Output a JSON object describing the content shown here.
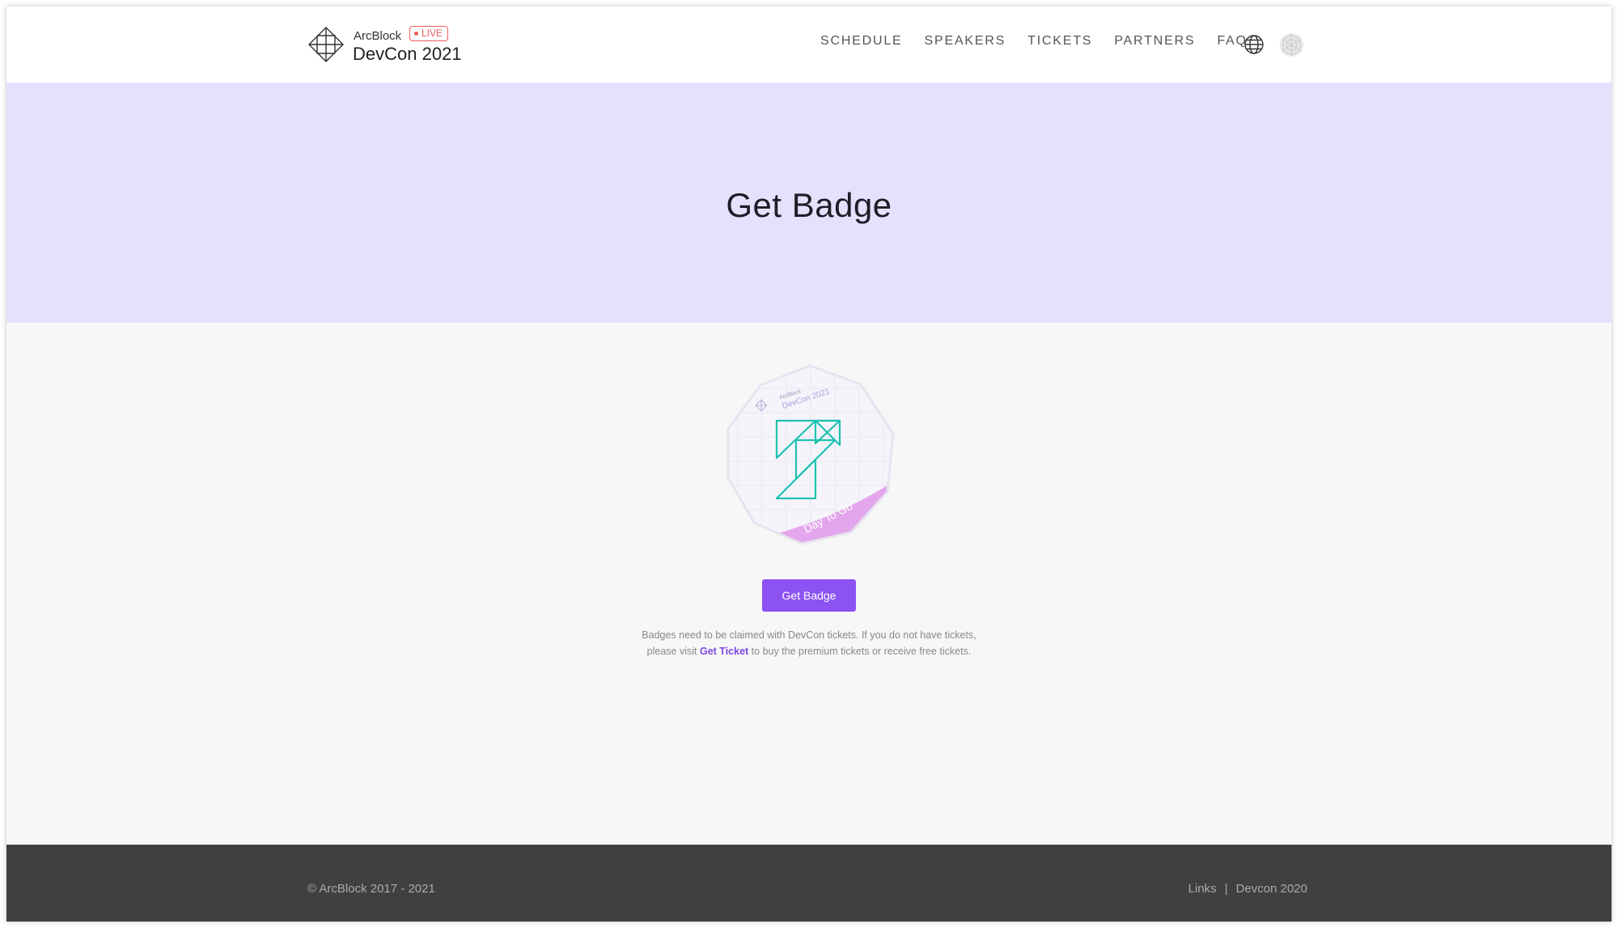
{
  "header": {
    "brand_small": "ArcBlock",
    "live_label": "LIVE",
    "brand_title": "DevCon 2021",
    "nav": [
      "SCHEDULE",
      "SPEAKERS",
      "TICKETS",
      "PARTNERS",
      "FAQ"
    ]
  },
  "hero": {
    "title": "Get Badge"
  },
  "badge": {
    "brand_small": "ArcBlock",
    "brand_title": "DevCon 2021",
    "ribbon": "Day To Go",
    "colors": {
      "accent": "#1ec2b0",
      "ribbon": "#e3a6ec"
    }
  },
  "main": {
    "button_label": "Get Badge",
    "note_line1": "Badges need to be claimed with DevCon tickets. If you do not have tickets,",
    "note_pre": "please visit ",
    "note_link": "Get Ticket",
    "note_post": " to buy the premium tickets or receive free tickets."
  },
  "footer": {
    "copyright": "© ArcBlock 2017 - 2021",
    "links": [
      "Links",
      "Devcon 2020"
    ],
    "separator": "|"
  },
  "colors": {
    "primary": "#8c52f2",
    "hero_bg": "#e5e1fd",
    "footer_bg": "#404040",
    "live": "#ef5a5a"
  }
}
